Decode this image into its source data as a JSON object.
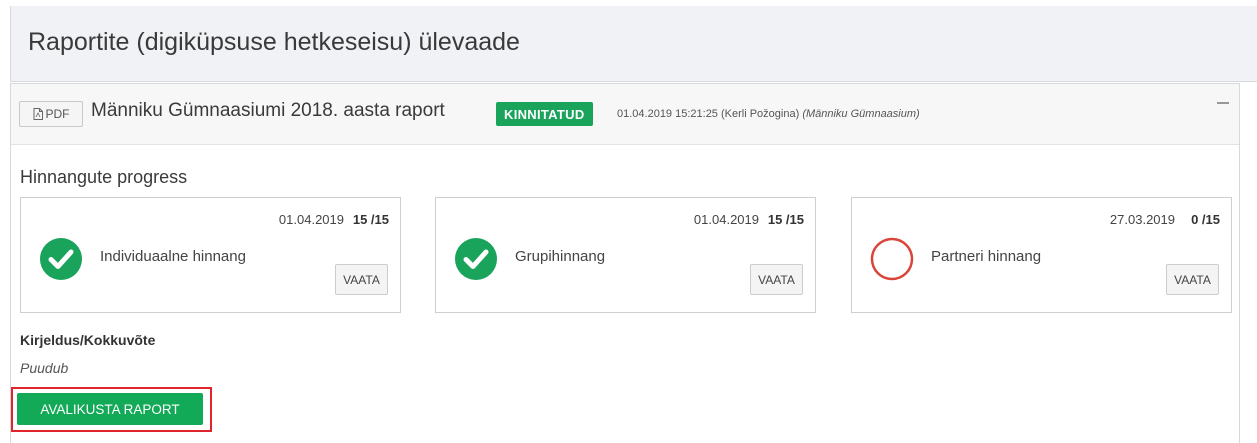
{
  "page": {
    "title": "Raportite (digiküpsuse hetkeseisu) ülevaade"
  },
  "report": {
    "pdf_label": "PDF",
    "name": "Männiku Gümnaasiumi 2018. aasta raport",
    "status": "KINNITATUD",
    "timestamp_user": "01.04.2019 15:21:25 (Kerli Požogina)",
    "school": "(Männiku Gümnaasium)",
    "section_title": "Hinnangute progress",
    "cards": [
      {
        "date": "01.04.2019",
        "count": "15 /15",
        "label": "Individuaalne hinnang",
        "state": "complete",
        "button": "VAATA"
      },
      {
        "date": "01.04.2019",
        "count": "15 /15",
        "label": "Grupihinnang",
        "state": "complete",
        "button": "VAATA"
      },
      {
        "date": "27.03.2019",
        "count": "0 /15",
        "label": "Partneri hinnang",
        "state": "incomplete",
        "button": "VAATA"
      }
    ],
    "description_label": "Kirjeldus/Kokkuvõte",
    "description_value": "Puudub",
    "publish_button": "AVALIKUSTA RAPORT"
  },
  "colors": {
    "accent_green": "#1aa35b",
    "button_green": "#12a957",
    "incomplete_red": "#d9453a",
    "highlight_red": "#e0242c"
  },
  "icons": {
    "pdf": "file-pdf-icon",
    "complete": "check-circle-icon",
    "incomplete": "empty-circle-icon",
    "collapse": "minus-icon"
  }
}
